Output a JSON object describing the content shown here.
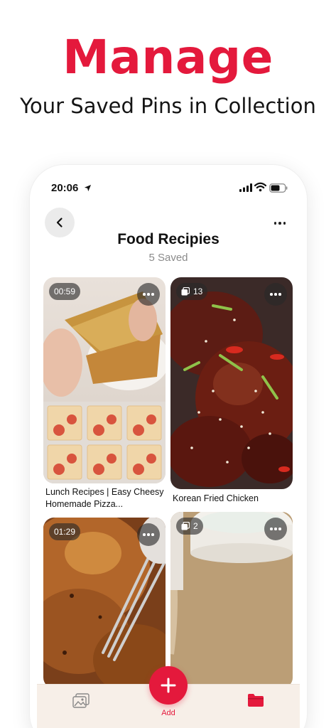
{
  "promo": {
    "headline": "Manage",
    "subheadline": "Your Saved Pins in Collection"
  },
  "status_bar": {
    "time": "20:06"
  },
  "header": {
    "title": "Food Recipies",
    "count": "5 Saved"
  },
  "pins": [
    {
      "badge": "00:59",
      "badge_type": "video",
      "title": "Lunch Recipes | Easy Cheesy Homemade Pizza..."
    },
    {
      "badge": "13",
      "badge_type": "collection",
      "title": "Korean Fried Chicken"
    },
    {
      "badge": "01:29",
      "badge_type": "video",
      "title": ""
    },
    {
      "badge": "2",
      "badge_type": "collection",
      "title": ""
    }
  ],
  "tab_bar": {
    "add_label": "Add",
    "icons": [
      "gallery-icon",
      "plus-icon",
      "folder-icon"
    ]
  },
  "colors": {
    "brand": "#e4193c",
    "tab_bar_bg": "#f7efe8"
  }
}
